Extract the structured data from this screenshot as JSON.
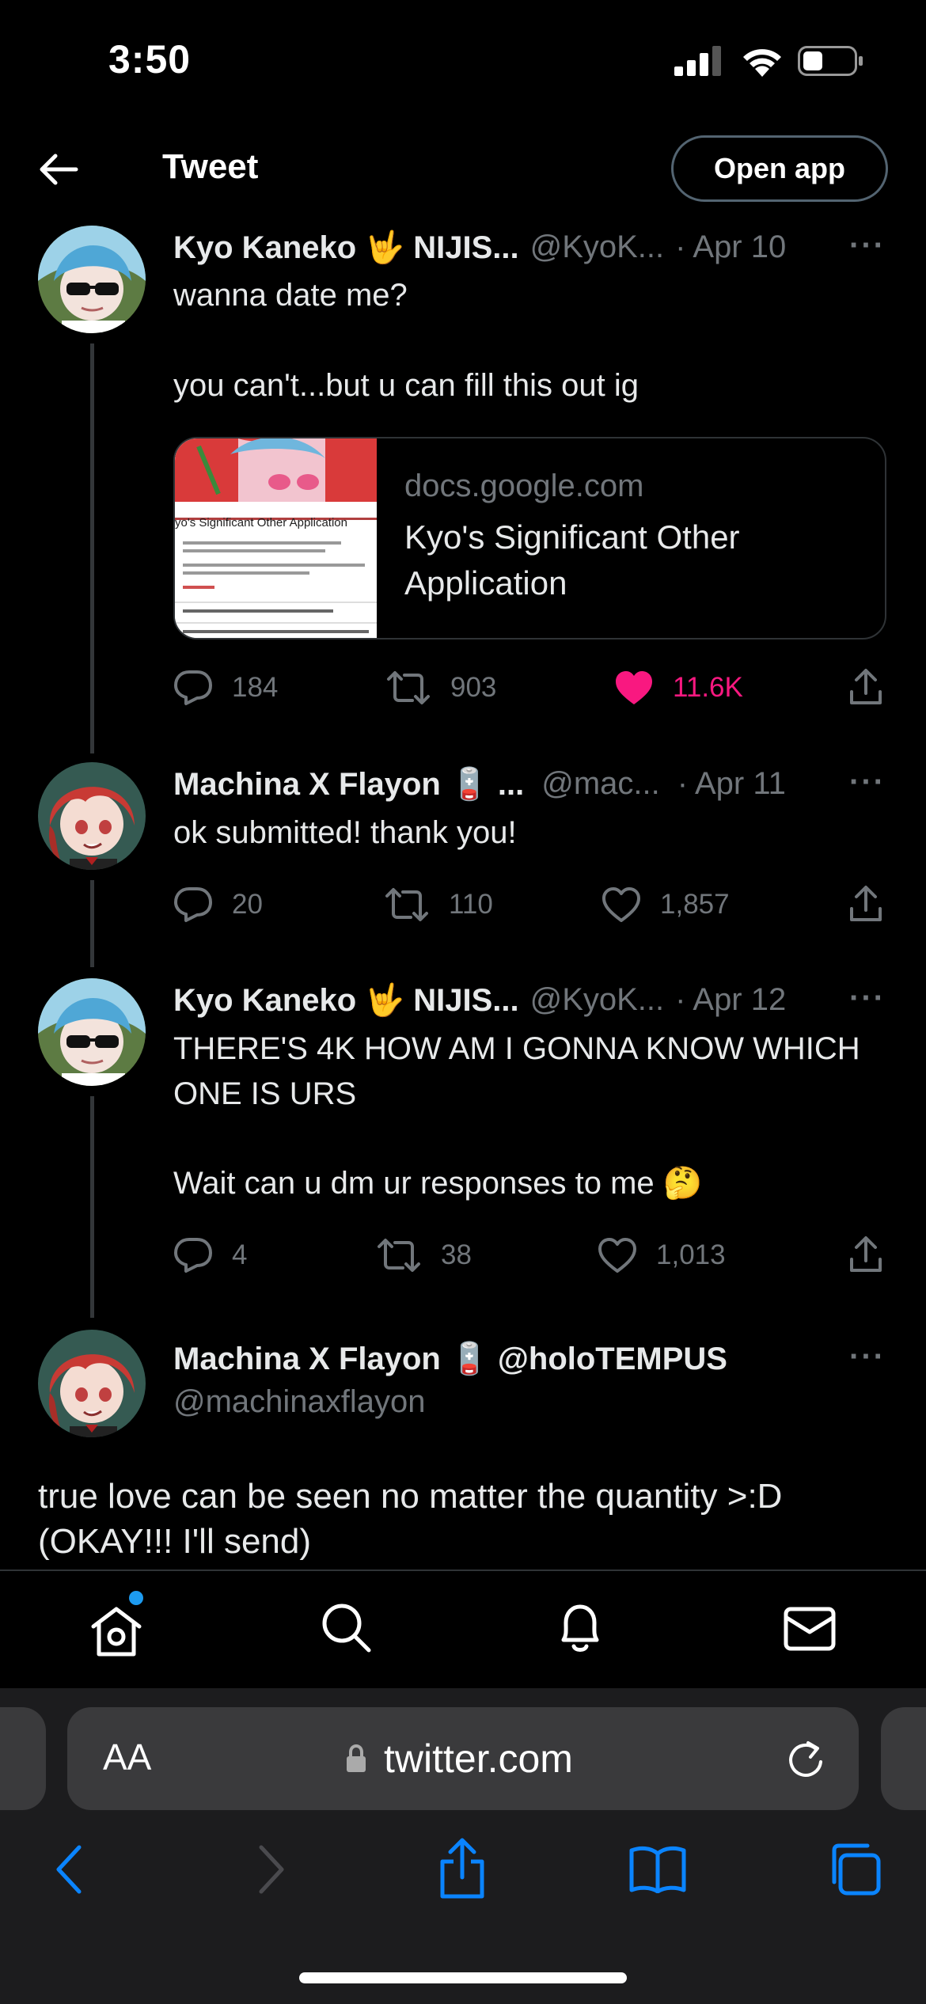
{
  "status_bar": {
    "time": "3:50"
  },
  "header": {
    "title": "Tweet",
    "open_app_label": "Open app"
  },
  "tweets": [
    {
      "name": "Kyo Kaneko 🤟 NIJIS...",
      "handle": "@KyoK...",
      "date": "· Apr 10",
      "more": "···",
      "text_line1": "wanna date me?",
      "text_line2": "you can't...but u can fill this out ig",
      "card": {
        "domain": "docs.google.com",
        "title": "Kyo's Significant Other Application",
        "thumb_heading": "yo's Significant Other Application"
      },
      "replies": "184",
      "retweets": "903",
      "likes": "11.6K",
      "liked": true
    },
    {
      "name": "Machina X Flayon 🪫 ...",
      "handle": "@mac...",
      "date": "· Apr 11",
      "more": "···",
      "text_line1": "ok submitted! thank you!",
      "replies": "20",
      "retweets": "110",
      "likes": "1,857",
      "liked": false
    },
    {
      "name": "Kyo Kaneko 🤟 NIJIS...",
      "handle": "@KyoK...",
      "date": "· Apr 12",
      "more": "···",
      "text_line1": "THERE'S 4K HOW AM I GONNA KNOW WHICH ONE IS URS",
      "text_line2": "Wait can u dm ur responses to me 🤔",
      "replies": "4",
      "retweets": "38",
      "likes": "1,013",
      "liked": false
    },
    {
      "name": "Machina X Flayon 🪫 @holoTEMPUS",
      "handle": "@machinaxflayon",
      "more": "···",
      "text": "true love can be seen no matter the quantity >:D (OKAY!!! I'll send)"
    }
  ],
  "nav": {
    "items": [
      "home-icon",
      "search-icon",
      "bell-icon",
      "mail-icon"
    ],
    "home_has_notification_dot": true
  },
  "safari": {
    "aa_label": "AA",
    "url": "twitter.com",
    "accent_color": "#0a84ff"
  },
  "colors": {
    "like": "#f91880",
    "muted": "#71767b",
    "text": "#e7e9ea",
    "border": "#2f3336"
  }
}
